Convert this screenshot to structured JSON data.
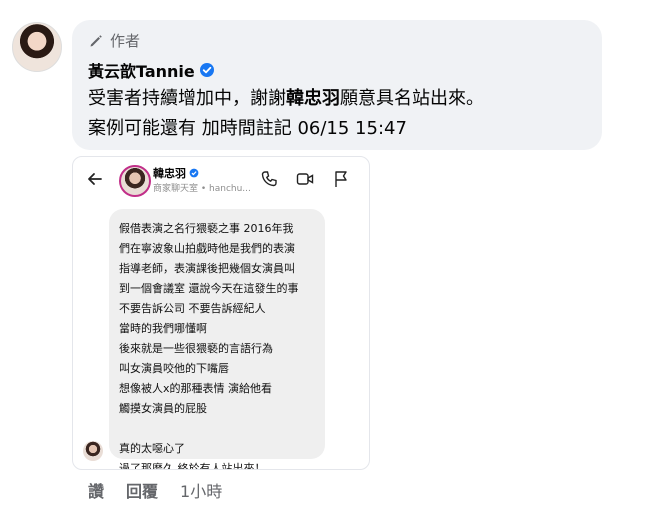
{
  "comment": {
    "author_label": "作者",
    "author_name": "黃云歆Tannie",
    "text_lines": [
      {
        "before": "受害者持續增加中，謝謝",
        "bold": "韓忠羽",
        "after": "願意具名站出來。"
      },
      {
        "before": "案例可能還有 加時間註記 06/15 15:47",
        "bold": "",
        "after": ""
      }
    ]
  },
  "screenshot": {
    "contact_name": "韓忠羽",
    "contact_sub": "商家聊天室 • hanchu...",
    "message_lines": [
      "假借表演之名行猥褻之事 2016年我",
      "們在寧波象山拍戲時他是我們的表演",
      "指導老師，表演課後把幾個女演員叫",
      "到一個會議室 還說今天在這發生的事",
      "不要告訴公司 不要告訴經紀人",
      "當時的我們哪懂啊",
      "後來就是一些很猥褻的言語行為",
      "叫女演員咬他的下嘴唇",
      "想像被人x的那種表情 演給他看",
      "觸摸女演員的屁股",
      "",
      "真的太噁心了",
      "過了那麼久 終於有人站出來！"
    ]
  },
  "actions": {
    "like": "讚",
    "reply": "回覆",
    "time": "1小時"
  },
  "icons": {
    "author": "pencil-icon",
    "verified": "verified-badge-icon",
    "back": "back-arrow-icon",
    "call": "phone-icon",
    "video": "video-icon",
    "flag": "flag-icon"
  },
  "colors": {
    "bubble_bg": "#f0f2f5",
    "verified_blue": "#1877f2",
    "muted_text": "#65676b",
    "message_bg": "#efefef"
  }
}
